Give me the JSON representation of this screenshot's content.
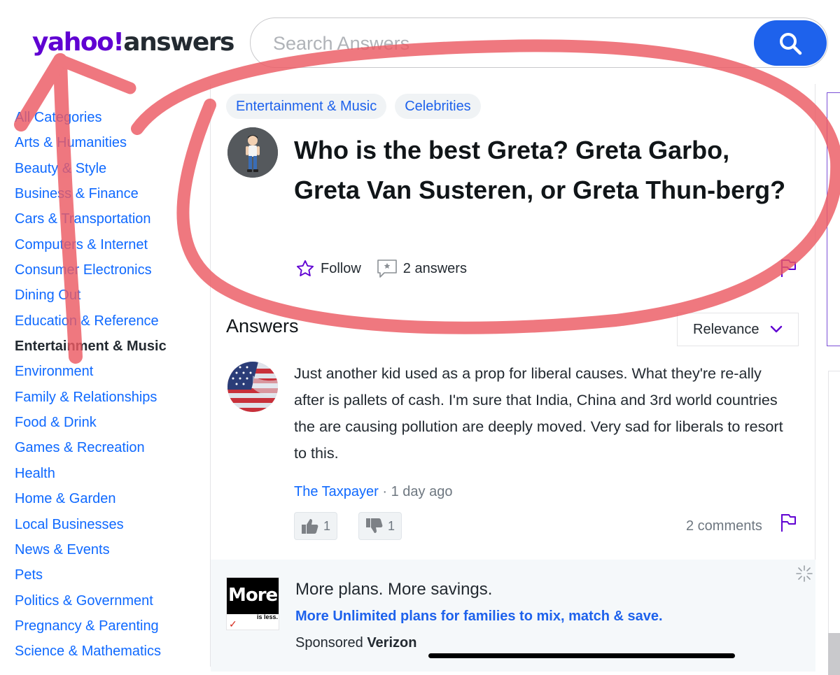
{
  "header": {
    "logo_yahoo": "yahoo!",
    "logo_answers": "answers",
    "search_placeholder": "Search Answers"
  },
  "sidebar": {
    "items": [
      {
        "label": "All Categories"
      },
      {
        "label": "Arts & Humanities"
      },
      {
        "label": "Beauty & Style"
      },
      {
        "label": "Business & Finance"
      },
      {
        "label": "Cars & Transportation"
      },
      {
        "label": "Computers & Internet"
      },
      {
        "label": "Consumer Electronics"
      },
      {
        "label": "Dining Out"
      },
      {
        "label": "Education & Reference"
      },
      {
        "label": "Entertainment & Music",
        "active": true
      },
      {
        "label": "Environment"
      },
      {
        "label": "Family & Relationships"
      },
      {
        "label": "Food & Drink"
      },
      {
        "label": "Games & Recreation"
      },
      {
        "label": "Health"
      },
      {
        "label": "Home & Garden"
      },
      {
        "label": "Local Businesses"
      },
      {
        "label": "News & Events"
      },
      {
        "label": "Pets"
      },
      {
        "label": "Politics & Government"
      },
      {
        "label": "Pregnancy & Parenting"
      },
      {
        "label": "Science & Mathematics"
      }
    ]
  },
  "question": {
    "tags": [
      "Entertainment & Music",
      "Celebrities"
    ],
    "title": "Who is the best Greta? Greta Garbo, Greta Van Susteren, or Greta Thun-berg?",
    "follow_label": "Follow",
    "answers_count": "2 answers"
  },
  "answers_section": {
    "heading": "Answers",
    "sort_label": "Relevance"
  },
  "answer": {
    "text": "Just another kid used as a prop for liberal causes. What they're re-ally after is pallets of cash. I'm sure that India, China and 3rd world countries the are causing pollution are deeply moved. Very sad for liberals to resort to this.",
    "user": "The Taxpayer",
    "time": " · 1 day ago",
    "upvotes": "1",
    "downvotes": "1",
    "comments": "2 comments"
  },
  "ad": {
    "logo_text": "More",
    "logo_sub": "is less.",
    "logo_check": "✓",
    "title": "More plans. More savings.",
    "subtitle": "More Unlimited plans for families to mix, match & save.",
    "sponsored": "Sponsored",
    "sponsor": "Verizon"
  },
  "colors": {
    "brand_purple": "#6001d2",
    "link_blue": "#0f69ff",
    "search_button": "#1e62ec",
    "annotation_red": "#ec5a63"
  }
}
